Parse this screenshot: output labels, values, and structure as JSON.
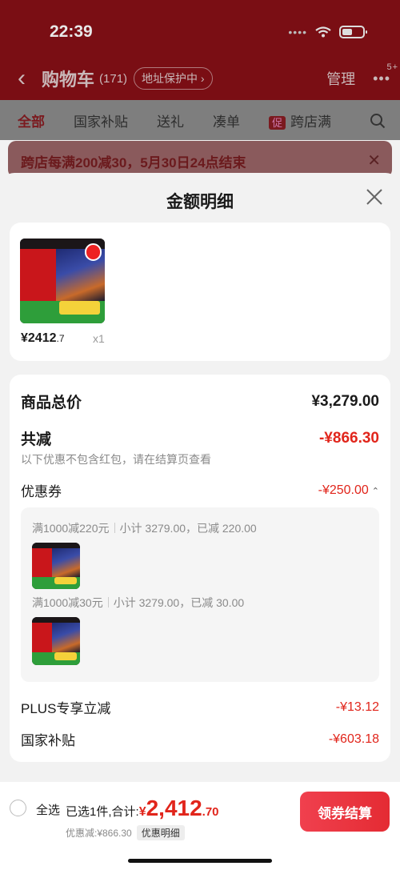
{
  "status_bar": {
    "time": "22:39"
  },
  "header": {
    "title": "购物车",
    "count": "(171)",
    "address_protect": "地址保护中",
    "manage": "管理",
    "more_badge": "5+"
  },
  "tabs": [
    {
      "label": "全部",
      "active": true
    },
    {
      "label": "国家补贴"
    },
    {
      "label": "送礼"
    },
    {
      "label": "凑单"
    },
    {
      "label": "跨店满",
      "tag": "促"
    }
  ],
  "promo_banner": {
    "text": "跨店每满200减30，5月30日24点结束"
  },
  "sheet": {
    "title": "金额明细",
    "product": {
      "price_int": "¥2412",
      "price_dec": ".7",
      "qty": "x1"
    },
    "summary": {
      "total_label": "商品总价",
      "total_value": "¥3,279.00",
      "reduction_label": "共减",
      "reduction_value": "-¥866.30",
      "reduction_note": "以下优惠不包含红包，请在结算页查看",
      "coupon_label": "优惠券",
      "coupon_value": "-¥250.00",
      "coupons": [
        {
          "rule": "满1000减220元",
          "detail": "小计 3279.00，已减 220.00"
        },
        {
          "rule": "满1000减30元",
          "detail": "小计 3279.00，已减 30.00"
        }
      ],
      "plus_label": "PLUS专享立减",
      "plus_value": "-¥13.12",
      "subsidy_label": "国家补贴",
      "subsidy_value": "-¥603.18"
    }
  },
  "bottom_bar": {
    "select_all": "全选",
    "selected_prefix": "已选1件,合计:",
    "total_symbol": "¥",
    "total_int": "2,412",
    "total_dec": ".70",
    "discount": "优惠减:¥866.30",
    "detail_link": "优惠明细",
    "checkout": "领券结算"
  },
  "colors": {
    "accent_red": "#e1251b",
    "header_dim": "#7a0e14"
  }
}
